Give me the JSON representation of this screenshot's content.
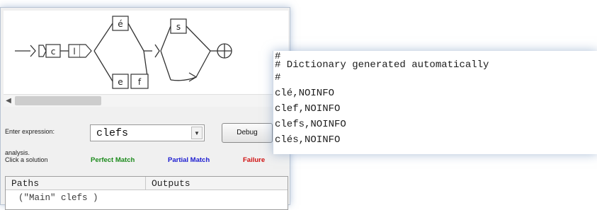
{
  "graph": {
    "box_labels": [
      "c",
      "l",
      "é",
      "e",
      "f",
      "s"
    ],
    "icons": [
      "initial-state-line-icon",
      "final-state-circle-icon"
    ]
  },
  "expression": {
    "label": "Enter expression:",
    "value": "clefs",
    "dropdown_icon": "chevron-down-icon"
  },
  "debug_label": "Debug",
  "hint": {
    "line1": "analysis.",
    "line2": "Click a solution"
  },
  "legend": {
    "perfect": "Perfect Match",
    "partial": "Partial Match",
    "failure": "Failure",
    "colors": {
      "perfect": "#1b8a1b",
      "partial": "#1a1ad0",
      "failure": "#d01010"
    }
  },
  "table": {
    "headers": [
      "Paths",
      "Outputs"
    ],
    "rows": [
      [
        "(\"Main\" clefs )",
        ""
      ]
    ]
  },
  "dictionary": {
    "lines": [
      "#",
      "# Dictionary generated automatically",
      "#",
      "clé,NOINFO",
      "clef,NOINFO",
      "clefs,NOINFO",
      "clés,NOINFO"
    ]
  }
}
